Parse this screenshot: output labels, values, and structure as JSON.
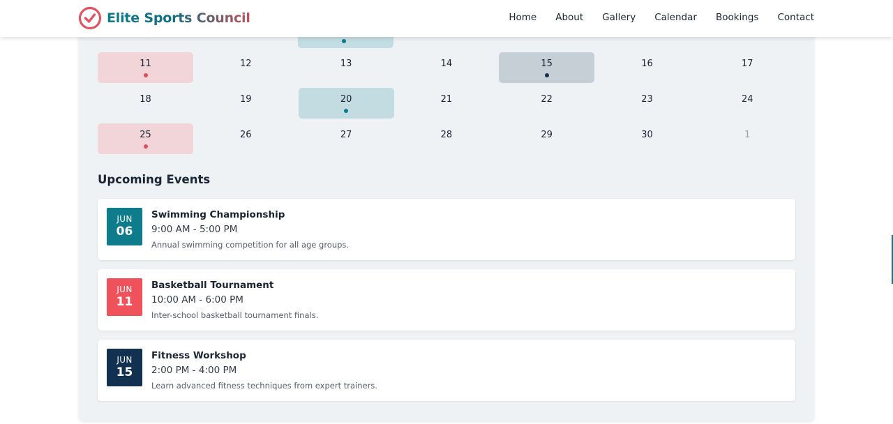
{
  "brand": {
    "name": "Elite Sports Council",
    "accent": "#0d7c8c",
    "logo_color": "#e05561"
  },
  "nav": [
    {
      "label": "Home"
    },
    {
      "label": "About"
    },
    {
      "label": "Gallery"
    },
    {
      "label": "Calendar"
    },
    {
      "label": "Bookings"
    },
    {
      "label": "Contact"
    }
  ],
  "calendar": {
    "rows": [
      [
        {
          "day": "11",
          "state": "red"
        },
        {
          "day": "12",
          "state": ""
        },
        {
          "day": "13",
          "state": ""
        },
        {
          "day": "14",
          "state": ""
        },
        {
          "day": "15",
          "state": "gray"
        },
        {
          "day": "16",
          "state": ""
        },
        {
          "day": "17",
          "state": ""
        }
      ],
      [
        {
          "day": "18",
          "state": ""
        },
        {
          "day": "19",
          "state": ""
        },
        {
          "day": "20",
          "state": "teal"
        },
        {
          "day": "21",
          "state": ""
        },
        {
          "day": "22",
          "state": ""
        },
        {
          "day": "23",
          "state": ""
        },
        {
          "day": "24",
          "state": ""
        }
      ],
      [
        {
          "day": "25",
          "state": "red"
        },
        {
          "day": "26",
          "state": ""
        },
        {
          "day": "27",
          "state": ""
        },
        {
          "day": "28",
          "state": ""
        },
        {
          "day": "29",
          "state": ""
        },
        {
          "day": "30",
          "state": ""
        },
        {
          "day": "1",
          "state": "muted"
        }
      ]
    ]
  },
  "upcoming": {
    "title": "Upcoming Events",
    "events": [
      {
        "month": "JUN",
        "day": "06",
        "title": "Swimming Championship",
        "time": "9:00 AM - 5:00 PM",
        "description": "Annual swimming competition for all age groups.",
        "color": "#0e7c8a"
      },
      {
        "month": "JUN",
        "day": "11",
        "title": "Basketball Tournament",
        "time": "10:00 AM - 6:00 PM",
        "description": "Inter-school basketball tournament finals.",
        "color": "#f0525c"
      },
      {
        "month": "JUN",
        "day": "15",
        "title": "Fitness Workshop",
        "time": "2:00 PM - 4:00 PM",
        "description": "Learn advanced fitness techniques from expert trainers.",
        "color": "#12304f"
      }
    ]
  }
}
